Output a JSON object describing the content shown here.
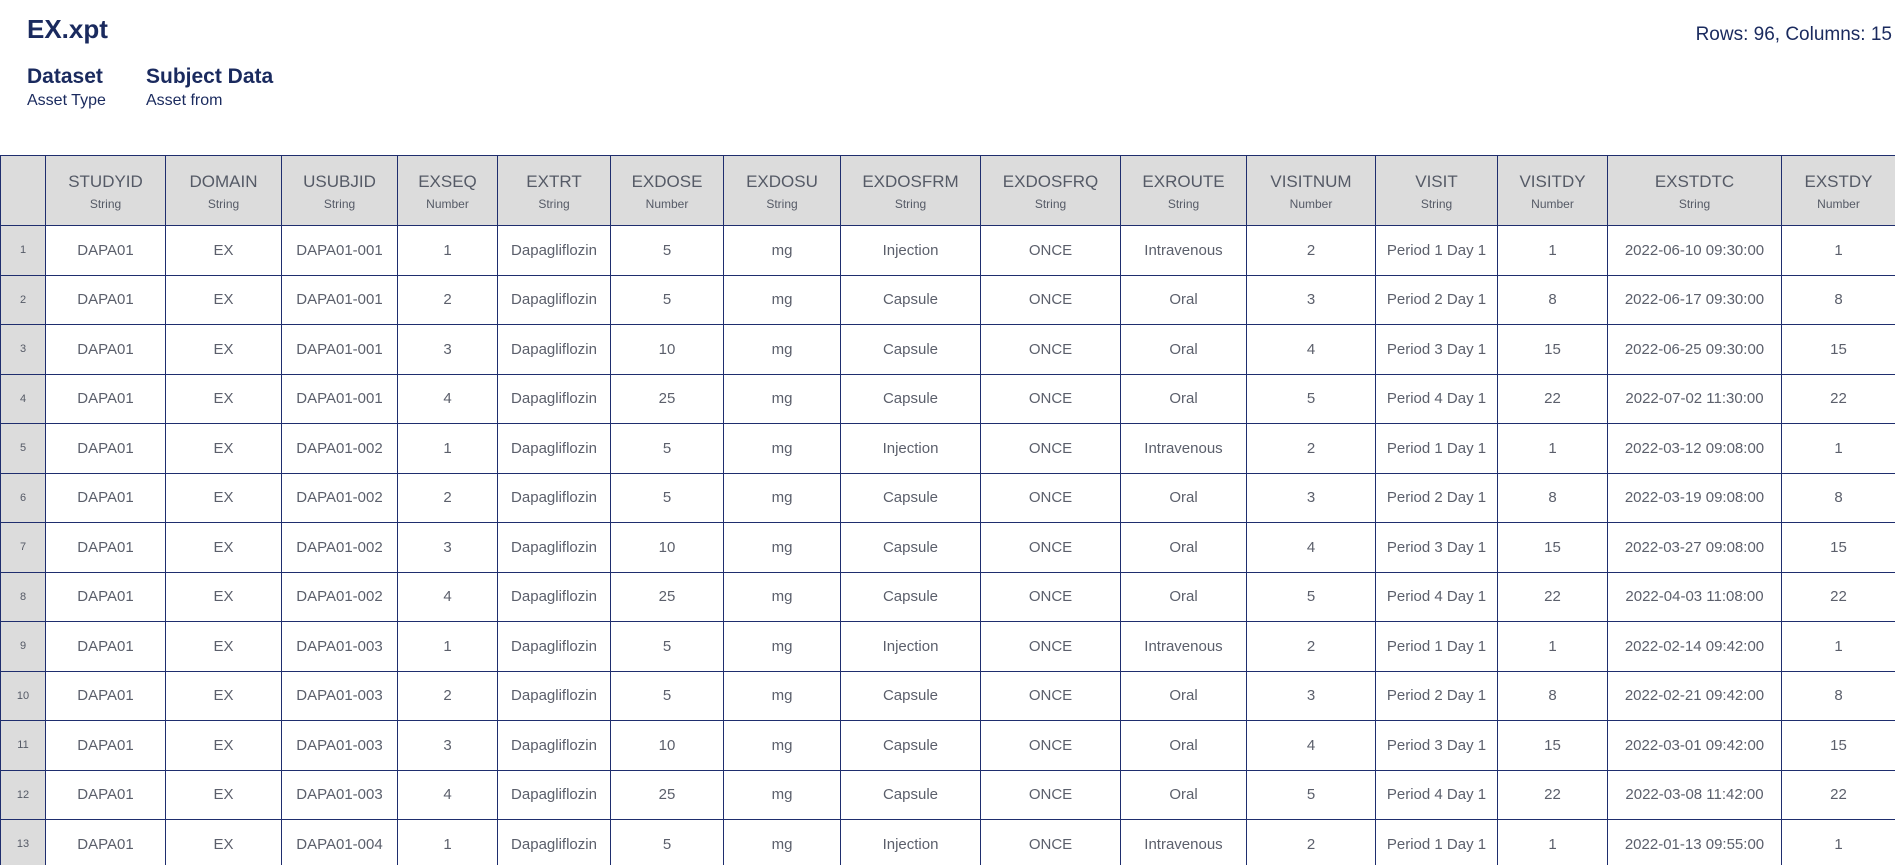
{
  "file_title": "EX.xpt",
  "meta": {
    "asset_type_value": "Dataset",
    "asset_type_label": "Asset Type",
    "asset_from_value": "Subject Data",
    "asset_from_label": "Asset from"
  },
  "counts_text": "Rows: 96, Columns: 15",
  "columns": [
    {
      "name": "STUDYID",
      "type": "String"
    },
    {
      "name": "DOMAIN",
      "type": "String"
    },
    {
      "name": "USUBJID",
      "type": "String"
    },
    {
      "name": "EXSEQ",
      "type": "Number"
    },
    {
      "name": "EXTRT",
      "type": "String"
    },
    {
      "name": "EXDOSE",
      "type": "Number"
    },
    {
      "name": "EXDOSU",
      "type": "String"
    },
    {
      "name": "EXDOSFRM",
      "type": "String"
    },
    {
      "name": "EXDOSFRQ",
      "type": "String"
    },
    {
      "name": "EXROUTE",
      "type": "String"
    },
    {
      "name": "VISITNUM",
      "type": "Number"
    },
    {
      "name": "VISIT",
      "type": "String"
    },
    {
      "name": "VISITDY",
      "type": "Number"
    },
    {
      "name": "EXSTDTC",
      "type": "String"
    },
    {
      "name": "EXSTDY",
      "type": "Number"
    }
  ],
  "rows": [
    {
      "num": "1",
      "cells": [
        "DAPA01",
        "EX",
        "DAPA01-001",
        "1",
        "Dapagliflozin",
        "5",
        "mg",
        "Injection",
        "ONCE",
        "Intravenous",
        "2",
        "Period 1 Day 1",
        "1",
        "2022-06-10 09:30:00",
        "1"
      ]
    },
    {
      "num": "2",
      "cells": [
        "DAPA01",
        "EX",
        "DAPA01-001",
        "2",
        "Dapagliflozin",
        "5",
        "mg",
        "Capsule",
        "ONCE",
        "Oral",
        "3",
        "Period 2 Day 1",
        "8",
        "2022-06-17 09:30:00",
        "8"
      ]
    },
    {
      "num": "3",
      "cells": [
        "DAPA01",
        "EX",
        "DAPA01-001",
        "3",
        "Dapagliflozin",
        "10",
        "mg",
        "Capsule",
        "ONCE",
        "Oral",
        "4",
        "Period 3 Day 1",
        "15",
        "2022-06-25 09:30:00",
        "15"
      ]
    },
    {
      "num": "4",
      "cells": [
        "DAPA01",
        "EX",
        "DAPA01-001",
        "4",
        "Dapagliflozin",
        "25",
        "mg",
        "Capsule",
        "ONCE",
        "Oral",
        "5",
        "Period 4 Day 1",
        "22",
        "2022-07-02 11:30:00",
        "22"
      ]
    },
    {
      "num": "5",
      "cells": [
        "DAPA01",
        "EX",
        "DAPA01-002",
        "1",
        "Dapagliflozin",
        "5",
        "mg",
        "Injection",
        "ONCE",
        "Intravenous",
        "2",
        "Period 1 Day 1",
        "1",
        "2022-03-12 09:08:00",
        "1"
      ]
    },
    {
      "num": "6",
      "cells": [
        "DAPA01",
        "EX",
        "DAPA01-002",
        "2",
        "Dapagliflozin",
        "5",
        "mg",
        "Capsule",
        "ONCE",
        "Oral",
        "3",
        "Period 2 Day 1",
        "8",
        "2022-03-19 09:08:00",
        "8"
      ]
    },
    {
      "num": "7",
      "cells": [
        "DAPA01",
        "EX",
        "DAPA01-002",
        "3",
        "Dapagliflozin",
        "10",
        "mg",
        "Capsule",
        "ONCE",
        "Oral",
        "4",
        "Period 3 Day 1",
        "15",
        "2022-03-27 09:08:00",
        "15"
      ]
    },
    {
      "num": "8",
      "cells": [
        "DAPA01",
        "EX",
        "DAPA01-002",
        "4",
        "Dapagliflozin",
        "25",
        "mg",
        "Capsule",
        "ONCE",
        "Oral",
        "5",
        "Period 4 Day 1",
        "22",
        "2022-04-03 11:08:00",
        "22"
      ]
    },
    {
      "num": "9",
      "cells": [
        "DAPA01",
        "EX",
        "DAPA01-003",
        "1",
        "Dapagliflozin",
        "5",
        "mg",
        "Injection",
        "ONCE",
        "Intravenous",
        "2",
        "Period 1 Day 1",
        "1",
        "2022-02-14 09:42:00",
        "1"
      ]
    },
    {
      "num": "10",
      "cells": [
        "DAPA01",
        "EX",
        "DAPA01-003",
        "2",
        "Dapagliflozin",
        "5",
        "mg",
        "Capsule",
        "ONCE",
        "Oral",
        "3",
        "Period 2 Day 1",
        "8",
        "2022-02-21 09:42:00",
        "8"
      ]
    },
    {
      "num": "11",
      "cells": [
        "DAPA01",
        "EX",
        "DAPA01-003",
        "3",
        "Dapagliflozin",
        "10",
        "mg",
        "Capsule",
        "ONCE",
        "Oral",
        "4",
        "Period 3 Day 1",
        "15",
        "2022-03-01 09:42:00",
        "15"
      ]
    },
    {
      "num": "12",
      "cells": [
        "DAPA01",
        "EX",
        "DAPA01-003",
        "4",
        "Dapagliflozin",
        "25",
        "mg",
        "Capsule",
        "ONCE",
        "Oral",
        "5",
        "Period 4 Day 1",
        "22",
        "2022-03-08 11:42:00",
        "22"
      ]
    },
    {
      "num": "13",
      "cells": [
        "DAPA01",
        "EX",
        "DAPA01-004",
        "1",
        "Dapagliflozin",
        "5",
        "mg",
        "Injection",
        "ONCE",
        "Intravenous",
        "2",
        "Period 1 Day 1",
        "1",
        "2022-01-13 09:55:00",
        "1"
      ]
    }
  ]
}
